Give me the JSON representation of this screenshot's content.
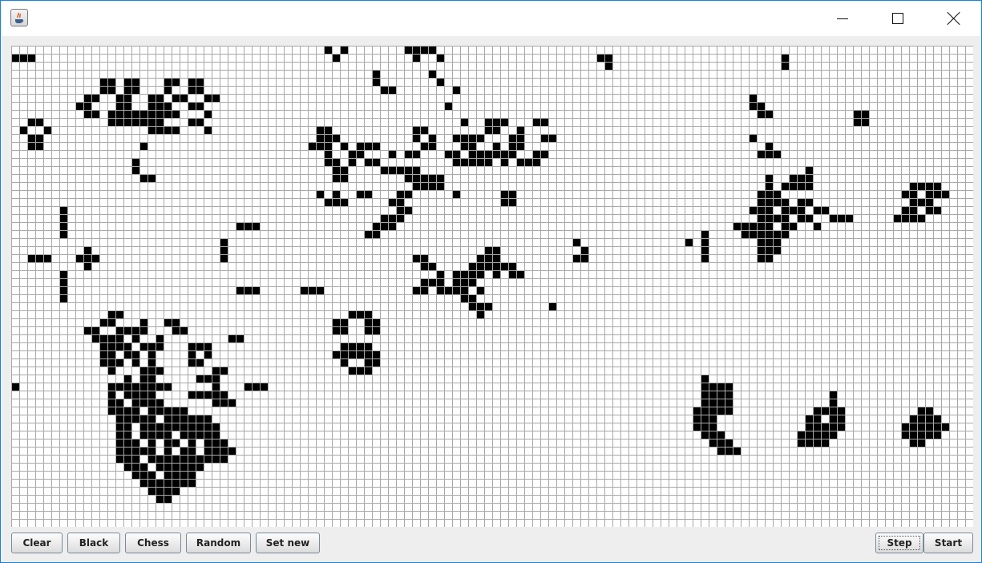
{
  "window": {
    "app_icon": "java-coffee-cup-icon",
    "controls": [
      "minimize-icon",
      "maximize-icon",
      "close-icon"
    ]
  },
  "grid": {
    "columns": 120,
    "rows": 60,
    "live_color": "#000000",
    "dead_color": "#ffffff",
    "line_color": "#a8a8a8",
    "live_cells_by_row": {
      "0": [
        39,
        41,
        49,
        50,
        51,
        52
      ],
      "1": [
        0,
        1,
        2,
        40,
        50,
        53,
        73,
        74,
        96
      ],
      "2": [
        74,
        96
      ],
      "3": [
        45,
        52
      ],
      "4": [
        11,
        12,
        14,
        15,
        19,
        20,
        22,
        23,
        45,
        53
      ],
      "5": [
        11,
        12,
        14,
        15,
        19,
        22,
        23,
        46,
        47,
        55
      ],
      "6": [
        9,
        10,
        13,
        14,
        17,
        18,
        20,
        21,
        24,
        25,
        92
      ],
      "7": [
        8,
        9,
        13,
        14,
        17,
        18,
        19,
        22,
        23,
        54,
        92,
        93
      ],
      "8": [
        9,
        10,
        12,
        13,
        14,
        15,
        16,
        17,
        18,
        19,
        20,
        24,
        93,
        94,
        105,
        106
      ],
      "9": [
        2,
        3,
        12,
        13,
        14,
        15,
        16,
        17,
        18,
        22,
        23,
        56,
        59,
        60,
        61,
        65,
        66,
        105,
        106
      ],
      "10": [
        1,
        4,
        17,
        18,
        19,
        20,
        24,
        38,
        39,
        50,
        51,
        59,
        60,
        63
      ],
      "11": [
        2,
        3,
        38,
        39,
        40,
        50,
        52,
        55,
        56,
        57,
        58,
        62,
        63,
        66,
        67,
        92
      ],
      "12": [
        2,
        3,
        16,
        37,
        38,
        39,
        41,
        43,
        44,
        45,
        51,
        52,
        56,
        57,
        60,
        62,
        63,
        94
      ],
      "13": [
        39,
        42,
        43,
        47,
        49,
        50,
        54,
        55,
        57,
        58,
        59,
        60,
        61,
        62,
        65,
        66,
        93,
        94,
        95
      ],
      "14": [
        15,
        39,
        40,
        42,
        44,
        45,
        55,
        56,
        57,
        58,
        59,
        61,
        63,
        64,
        65
      ],
      "15": [
        15,
        40,
        41,
        46,
        47,
        48,
        49,
        50,
        99
      ],
      "16": [
        16,
        17,
        40,
        41,
        49,
        50,
        51,
        52,
        53,
        94,
        97,
        98,
        99
      ],
      "17": [
        50,
        51,
        52,
        53,
        94,
        96,
        97,
        98,
        99,
        112,
        113,
        114,
        115
      ],
      "18": [
        38,
        40,
        43,
        44,
        48,
        49,
        55,
        61,
        62,
        93,
        94,
        95,
        111,
        112,
        114,
        115,
        116
      ],
      "19": [
        39,
        40,
        41,
        47,
        48,
        61,
        62,
        93,
        94,
        95,
        96,
        98,
        99,
        112,
        113,
        114
      ],
      "20": [
        6,
        48,
        49,
        92,
        93,
        94,
        96,
        97,
        98,
        100,
        101,
        111,
        112,
        114,
        115
      ],
      "21": [
        6,
        46,
        47,
        48,
        93,
        94,
        95,
        96,
        98,
        99,
        102,
        103,
        104,
        110,
        111,
        112,
        113
      ],
      "22": [
        6,
        28,
        29,
        30,
        45,
        46,
        47,
        90,
        91,
        92,
        93,
        94,
        96,
        97,
        100
      ],
      "23": [
        6,
        44,
        45,
        86,
        91,
        92,
        93,
        94,
        95,
        96
      ],
      "24": [
        26,
        70,
        84,
        86,
        93,
        94,
        95
      ],
      "25": [
        9,
        26,
        59,
        60,
        71,
        86,
        93,
        94,
        95
      ],
      "26": [
        2,
        3,
        4,
        8,
        9,
        10,
        26,
        50,
        51,
        58,
        59,
        60,
        70,
        71,
        86,
        93,
        94
      ],
      "27": [
        9,
        51,
        52,
        57,
        58,
        59,
        60,
        61,
        62
      ],
      "28": [
        6,
        53,
        55,
        56,
        57,
        58,
        60,
        62,
        63
      ],
      "29": [
        6,
        51,
        52,
        53,
        55,
        56,
        57
      ],
      "30": [
        6,
        28,
        29,
        30,
        36,
        37,
        38,
        50,
        51,
        53,
        54,
        55,
        56,
        58
      ],
      "31": [
        6,
        56,
        57
      ],
      "32": [
        57,
        58,
        59,
        67
      ],
      "33": [
        12,
        13,
        42,
        43,
        44,
        58
      ],
      "34": [
        11,
        12,
        16,
        19,
        20,
        40,
        41,
        44,
        45
      ],
      "35": [
        9,
        10,
        13,
        14,
        15,
        16,
        20,
        21,
        40,
        41,
        44,
        45
      ],
      "36": [
        10,
        11,
        12,
        13,
        15,
        18,
        27,
        28
      ],
      "37": [
        11,
        12,
        13,
        14,
        16,
        17,
        18,
        22,
        23,
        24,
        41,
        42,
        43,
        44
      ],
      "38": [
        11,
        12,
        14,
        15,
        17,
        22,
        24,
        40,
        41,
        42,
        43,
        44,
        45
      ],
      "39": [
        11,
        12,
        13,
        15,
        17,
        22,
        23,
        41,
        44,
        45
      ],
      "40": [
        12,
        16,
        17,
        18,
        25,
        26,
        42,
        43,
        44
      ],
      "41": [
        14,
        16,
        17,
        23,
        24,
        25,
        86
      ],
      "42": [
        0,
        12,
        13,
        14,
        15,
        16,
        17,
        18,
        19,
        25,
        29,
        30,
        31,
        86,
        87,
        88,
        89
      ],
      "43": [
        12,
        14,
        15,
        16,
        17,
        22,
        23,
        24,
        25,
        26,
        86,
        87,
        88,
        89,
        102
      ],
      "44": [
        12,
        13,
        15,
        16,
        17,
        18,
        25,
        26,
        27,
        86,
        87,
        88,
        89,
        102
      ],
      "45": [
        12,
        13,
        14,
        15,
        17,
        18,
        19,
        20,
        21,
        85,
        86,
        87,
        88,
        89,
        100,
        101,
        102,
        103,
        113,
        114
      ],
      "46": [
        13,
        14,
        15,
        16,
        17,
        19,
        20,
        21,
        22,
        23,
        24,
        85,
        86,
        87,
        99,
        100,
        102,
        103,
        112,
        113,
        114,
        115
      ],
      "47": [
        13,
        14,
        16,
        17,
        18,
        19,
        20,
        21,
        22,
        23,
        24,
        25,
        85,
        86,
        87,
        99,
        100,
        101,
        102,
        103,
        111,
        112,
        113,
        114,
        115,
        116
      ],
      "48": [
        13,
        14,
        16,
        17,
        18,
        19,
        21,
        22,
        23,
        24,
        25,
        86,
        87,
        88,
        98,
        99,
        100,
        101,
        102,
        111,
        112,
        113,
        114,
        115
      ],
      "49": [
        13,
        14,
        15,
        17,
        19,
        20,
        22,
        24,
        25,
        26,
        87,
        88,
        89,
        98,
        99,
        100,
        101,
        112,
        113
      ],
      "50": [
        13,
        14,
        15,
        16,
        17,
        19,
        21,
        22,
        24,
        25,
        26,
        27,
        88,
        89,
        90
      ],
      "51": [
        13,
        14,
        15,
        17,
        18,
        19,
        20,
        21,
        22,
        23,
        24,
        25,
        26
      ],
      "52": [
        14,
        15,
        16,
        18,
        19,
        20,
        21,
        22,
        23
      ],
      "53": [
        15,
        16,
        17,
        19,
        20,
        21,
        22
      ],
      "54": [
        16,
        17,
        18,
        19,
        20,
        21,
        22
      ],
      "55": [
        17,
        18,
        19,
        20
      ],
      "56": [
        18,
        19
      ],
      "57": [],
      "58": [],
      "59": []
    }
  },
  "buttons": {
    "clear": "Clear",
    "black": "Black",
    "chess": "Chess",
    "random": "Random",
    "set_new": "Set new",
    "step": "Step",
    "start": "Start"
  }
}
